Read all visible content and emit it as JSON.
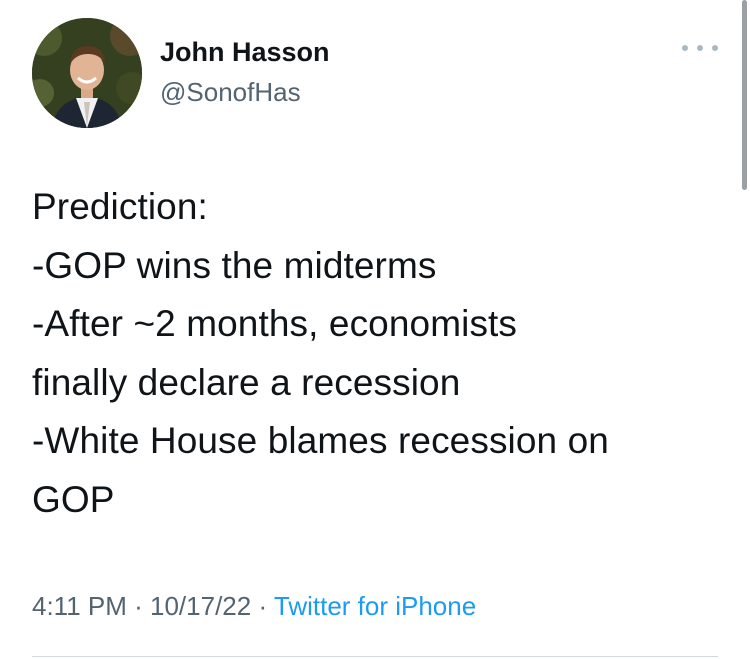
{
  "author": {
    "display_name": "John Hasson",
    "handle": "@SonofHas",
    "avatar_icon": "profile-photo"
  },
  "more_icon": "more-horizontal-icon",
  "tweet": {
    "lines": [
      "Prediction:",
      "-GOP wins the midterms",
      "-After ~2 months, economists",
      "finally declare a recession",
      "-White House blames recession on",
      "GOP"
    ]
  },
  "meta": {
    "time": "4:11 PM",
    "separator1": " · ",
    "date": "10/17/22",
    "separator2": " · ",
    "source": "Twitter for iPhone"
  },
  "colors": {
    "text": "#0f1419",
    "secondary": "#536471",
    "link": "#1d9bf0"
  }
}
